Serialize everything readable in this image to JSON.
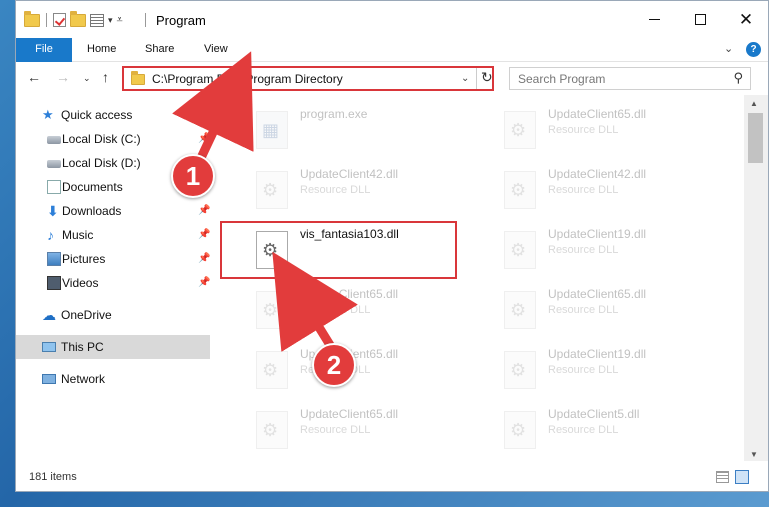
{
  "window": {
    "title": "Program",
    "controls": {
      "minimize": "—",
      "maximize": "☐",
      "close": "✕"
    }
  },
  "ribbon": {
    "tabs": [
      "File",
      "Home",
      "Share",
      "View"
    ],
    "help": "?"
  },
  "navigation": {
    "address": "C:\\Program Files\\Program Directory",
    "search_placeholder": "Search Program"
  },
  "sidebar": {
    "items": [
      {
        "label": "Quick access",
        "icon": "star-icon",
        "pinned": false
      },
      {
        "label": "Local Disk (C:)",
        "icon": "disk-icon",
        "pinned": true
      },
      {
        "label": "Local Disk (D:)",
        "icon": "disk-icon",
        "pinned": false
      },
      {
        "label": "Documents",
        "icon": "documents-icon",
        "pinned": true
      },
      {
        "label": "Downloads",
        "icon": "download-icon",
        "pinned": true
      },
      {
        "label": "Music",
        "icon": "music-icon",
        "pinned": true
      },
      {
        "label": "Pictures",
        "icon": "pictures-icon",
        "pinned": true
      },
      {
        "label": "Videos",
        "icon": "videos-icon",
        "pinned": true
      },
      {
        "label": "OneDrive",
        "icon": "onedrive-icon",
        "pinned": false
      },
      {
        "label": "This PC",
        "icon": "this-pc-icon",
        "pinned": false,
        "selected": true
      },
      {
        "label": "Network",
        "icon": "network-icon",
        "pinned": false
      }
    ]
  },
  "files": [
    {
      "name": "program.exe",
      "type": ""
    },
    {
      "name": "UpdateClient65.dll",
      "type": "Resource DLL"
    },
    {
      "name": "UpdateClient42.dll",
      "type": "Resource DLL"
    },
    {
      "name": "UpdateClient42.dll",
      "type": "Resource DLL"
    },
    {
      "name": "vis_fantasia103.dll",
      "type": ""
    },
    {
      "name": "UpdateClient19.dll",
      "type": "Resource DLL"
    },
    {
      "name": "UpdateClient65.dll",
      "type": "Resource DLL"
    },
    {
      "name": "UpdateClient65.dll",
      "type": "Resource DLL"
    },
    {
      "name": "UpdateClient65.dll",
      "type": "Resource DLL"
    },
    {
      "name": "UpdateClient19.dll",
      "type": "Resource DLL"
    },
    {
      "name": "UpdateClient65.dll",
      "type": "Resource DLL"
    },
    {
      "name": "UpdateClient5.dll",
      "type": "Resource DLL"
    }
  ],
  "status": {
    "item_count": "181 items"
  },
  "callouts": [
    "1",
    "2"
  ],
  "colors": {
    "accent": "#1979ca",
    "highlight": "#d9363a",
    "folder": "#f1c94c"
  }
}
